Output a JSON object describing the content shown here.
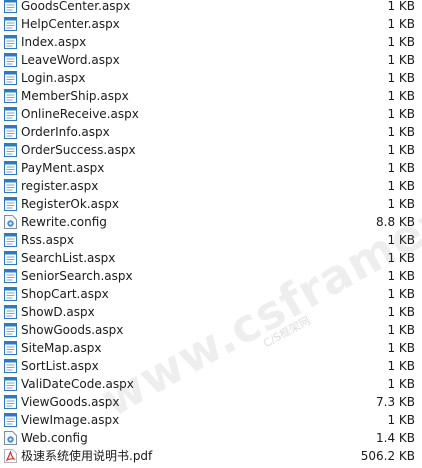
{
  "files": [
    {
      "name": "GoodsCenter.aspx",
      "size": "1 KB",
      "icon": "aspx-file-icon"
    },
    {
      "name": "HelpCenter.aspx",
      "size": "1 KB",
      "icon": "aspx-file-icon"
    },
    {
      "name": "Index.aspx",
      "size": "1 KB",
      "icon": "aspx-file-icon"
    },
    {
      "name": "LeaveWord.aspx",
      "size": "1 KB",
      "icon": "aspx-file-icon"
    },
    {
      "name": "Login.aspx",
      "size": "1 KB",
      "icon": "aspx-file-icon"
    },
    {
      "name": "MemberShip.aspx",
      "size": "1 KB",
      "icon": "aspx-file-icon"
    },
    {
      "name": "OnlineReceive.aspx",
      "size": "1 KB",
      "icon": "aspx-file-icon"
    },
    {
      "name": "OrderInfo.aspx",
      "size": "1 KB",
      "icon": "aspx-file-icon"
    },
    {
      "name": "OrderSuccess.aspx",
      "size": "1 KB",
      "icon": "aspx-file-icon"
    },
    {
      "name": "PayMent.aspx",
      "size": "1 KB",
      "icon": "aspx-file-icon"
    },
    {
      "name": "register.aspx",
      "size": "1 KB",
      "icon": "aspx-file-icon"
    },
    {
      "name": "RegisterOk.aspx",
      "size": "1 KB",
      "icon": "aspx-file-icon"
    },
    {
      "name": "Rewrite.config",
      "size": "8.8 KB",
      "icon": "config-file-icon"
    },
    {
      "name": "Rss.aspx",
      "size": "1 KB",
      "icon": "aspx-file-icon"
    },
    {
      "name": "SearchList.aspx",
      "size": "1 KB",
      "icon": "aspx-file-icon"
    },
    {
      "name": "SeniorSearch.aspx",
      "size": "1 KB",
      "icon": "aspx-file-icon"
    },
    {
      "name": "ShopCart.aspx",
      "size": "1 KB",
      "icon": "aspx-file-icon"
    },
    {
      "name": "ShowD.aspx",
      "size": "1 KB",
      "icon": "aspx-file-icon"
    },
    {
      "name": "ShowGoods.aspx",
      "size": "1 KB",
      "icon": "aspx-file-icon"
    },
    {
      "name": "SiteMap.aspx",
      "size": "1 KB",
      "icon": "aspx-file-icon"
    },
    {
      "name": "SortList.aspx",
      "size": "1 KB",
      "icon": "aspx-file-icon"
    },
    {
      "name": "ValiDateCode.aspx",
      "size": "1 KB",
      "icon": "aspx-file-icon"
    },
    {
      "name": "ViewGoods.aspx",
      "size": "7.3 KB",
      "icon": "aspx-file-icon"
    },
    {
      "name": "ViewImage.aspx",
      "size": "1 KB",
      "icon": "aspx-file-icon"
    },
    {
      "name": "Web.config",
      "size": "1.4 KB",
      "icon": "config-file-icon"
    },
    {
      "name": "极速系统使用说明书.pdf",
      "size": "506.2 KB",
      "icon": "pdf-file-icon"
    }
  ],
  "watermark": {
    "main": "www.csframework",
    "sub": "C/S框架网"
  },
  "colors": {
    "aspx_icon": "#2d7bbf",
    "config_icon": "#4a8fd0",
    "pdf_icon": "#d32f2f"
  }
}
